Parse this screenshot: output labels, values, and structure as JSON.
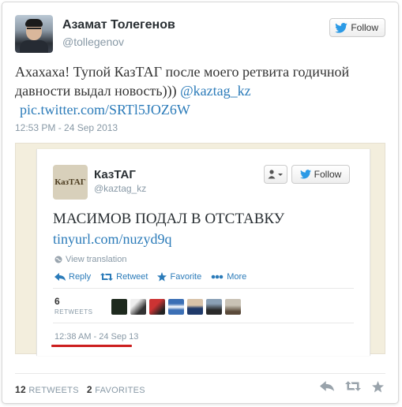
{
  "author": {
    "fullname": "Азамат Толегенов",
    "screenname": "@tollegenov"
  },
  "follow_button": {
    "label": "Follow"
  },
  "tweet": {
    "text": "Ахахаха! Тупой КазТАГ после моего ретвита годичной давности выдал новость)))",
    "mention": "@kaztag_kz",
    "link": "pic.twitter.com/SRTl5JOZ6W",
    "timestamp": "12:53 PM - 24 Sep 2013"
  },
  "embedded": {
    "avatar_text": "КазТАГ",
    "name": "КазТАГ",
    "handle": "@kaztag_kz",
    "follow_label": "Follow",
    "headline": "МАСИМОВ ПОДАЛ В ОТСТАВКУ",
    "link": "tinyurl.com/nuzyd9q",
    "translate_label": "View translation",
    "actions": {
      "reply": "Reply",
      "retweet": "Retweet",
      "favorite": "Favorite",
      "more": "More"
    },
    "retweet_count": "6",
    "retweet_label": "RETWEETS",
    "timestamp": "12:38 AM - 24 Sep 13"
  },
  "stats": {
    "retweets_count": "12",
    "retweets_label": "RETWEETS",
    "favorites_count": "2",
    "favorites_label": "FAVORITES"
  },
  "colors": {
    "link": "#2b7bb9",
    "muted": "#8899a6",
    "highlight": "#cc1f1f"
  }
}
